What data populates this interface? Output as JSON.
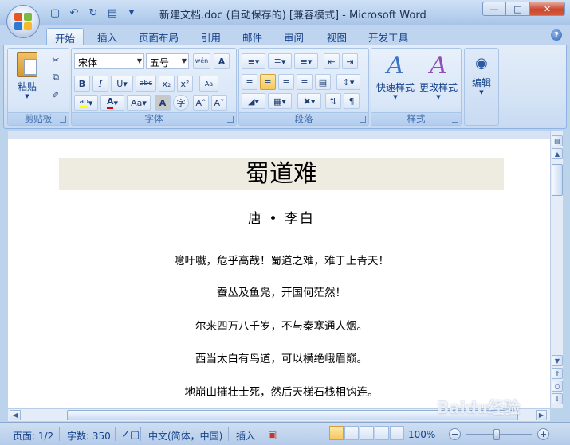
{
  "window": {
    "title": "新建文档.doc (自动保存的) [兼容模式] - Microsoft Word",
    "controls": [
      "minimize",
      "maximize",
      "close"
    ]
  },
  "tabs": [
    "开始",
    "插入",
    "页面布局",
    "引用",
    "邮件",
    "审阅",
    "视图",
    "开发工具"
  ],
  "active_tab": "开始",
  "ribbon": {
    "clipboard": {
      "label": "剪贴板",
      "paste": "粘贴"
    },
    "font": {
      "label": "字体",
      "font_name": "宋体",
      "font_size": "五号",
      "wen_button": "wén 文"
    },
    "paragraph": {
      "label": "段落"
    },
    "styles": {
      "label": "样式",
      "quick_styles": "快速样式",
      "change_styles": "更改样式"
    },
    "editing": {
      "label": "编辑"
    }
  },
  "document": {
    "title": "蜀道难",
    "author": "唐 • 李白",
    "lines": [
      "噫吁嚱，危乎高哉！蜀道之难，难于上青天！",
      "蚕丛及鱼凫，开国何茫然！",
      "尔来四万八千岁，不与秦塞通人烟。",
      "西当太白有鸟道，可以横绝峨眉巅。",
      "地崩山摧壮士死，然后天梯石栈相钩连。"
    ]
  },
  "status": {
    "page": "页面: 1/2",
    "words": "字数: 350",
    "language": "中文(简体，中国)",
    "mode": "插入",
    "zoom": "100%"
  },
  "watermark": "Baidu经验",
  "colors": {
    "accent": "#15428b",
    "ribbon_bg": "#d3e2f5",
    "heading_bg": "#eeece1"
  }
}
